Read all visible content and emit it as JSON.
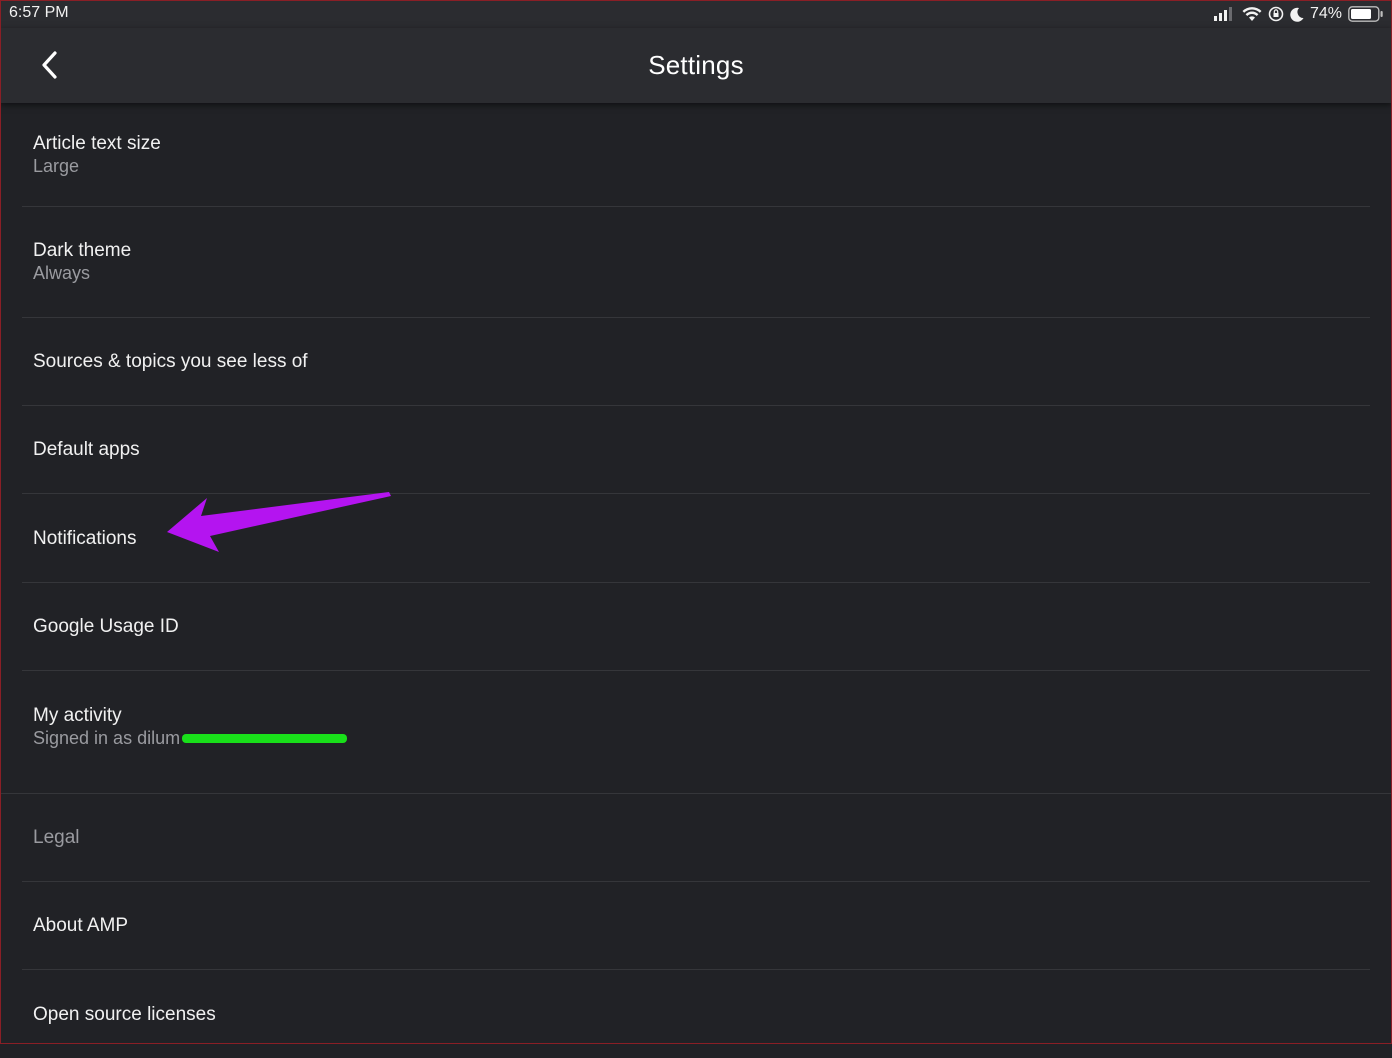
{
  "status_bar": {
    "time": "6:57 PM",
    "battery_percent": "74%",
    "icons": [
      "cellular-signal-icon",
      "wifi-icon",
      "rotation-lock-icon",
      "moon-icon",
      "battery-icon"
    ]
  },
  "app_bar": {
    "title": "Settings",
    "back_icon": "chevron-left-icon"
  },
  "settings": {
    "items": [
      {
        "title": "Article text size",
        "subtitle": "Large"
      },
      {
        "title": "Dark theme",
        "subtitle": "Always"
      },
      {
        "title": "Sources & topics you see less of"
      },
      {
        "title": "Default apps"
      },
      {
        "title": "Notifications"
      },
      {
        "title": "Google Usage ID"
      },
      {
        "title": "My activity",
        "subtitle": "Signed in as dilum"
      }
    ]
  },
  "about": {
    "items": [
      {
        "title": "Legal"
      },
      {
        "title": "About AMP"
      },
      {
        "title": "Open source licenses"
      }
    ]
  },
  "colors": {
    "background": "#212226",
    "app_bar": "#2b2c30",
    "annotation_arrow": "#b414f0",
    "redaction": "#19e01a"
  }
}
